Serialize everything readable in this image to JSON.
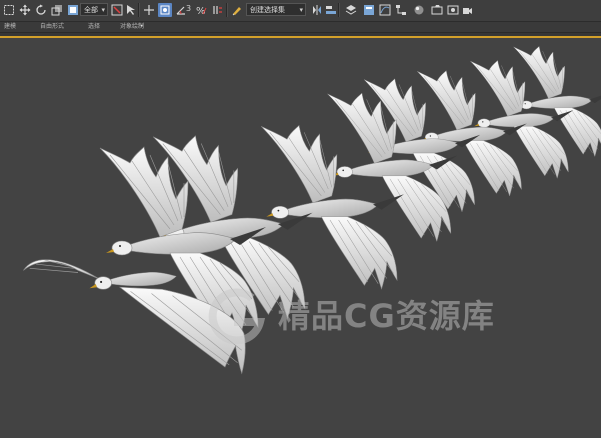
{
  "toolbar": {
    "count_label": "2",
    "filter_value": "全部",
    "selection_set_placeholder": "创建选择集",
    "snap_angle_label": "3",
    "snap_percent_label": "%"
  },
  "ribbon": {
    "tabs": [
      "建模",
      "自由形式",
      "选择",
      "对象绘制",
      "填充"
    ],
    "menu_glyph": "•"
  },
  "viewport": {
    "border_color": "#d3a02a",
    "background": "#434343",
    "content": "seagull-flock-render"
  },
  "watermark": {
    "text": "精品CG资源库"
  },
  "icons": [
    "select-region-icon",
    "select-move-icon",
    "select-rotate-icon",
    "select-scale-icon",
    "reference-coord-icon",
    "pivot-icon",
    "select-manipulate-icon",
    "keyboard-shortcut-icon",
    "snap-icon",
    "angle-snap-icon",
    "percent-snap-icon",
    "spinner-snap-icon",
    "edit-named-selection-icon",
    "mirror-icon",
    "align-icon",
    "layer-explorer-icon",
    "graphite-toggle-icon",
    "curve-editor-icon",
    "schematic-view-icon",
    "material-editor-icon",
    "render-setup-icon",
    "rendered-frame-icon",
    "render-production-icon"
  ]
}
